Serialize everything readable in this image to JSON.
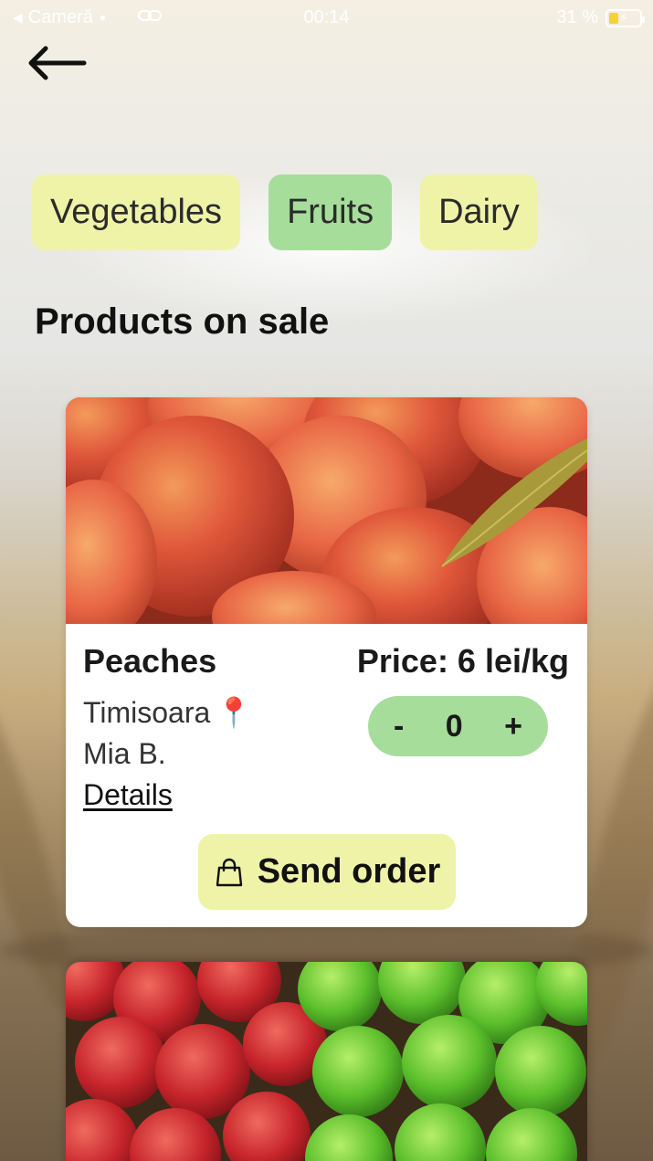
{
  "status_bar": {
    "back_app": "Cameră",
    "time": "00:14",
    "battery": "31 %",
    "battery_level": 0.31
  },
  "categories": [
    {
      "label": "Vegetables",
      "active": false
    },
    {
      "label": "Fruits",
      "active": true
    },
    {
      "label": "Dairy",
      "active": false
    }
  ],
  "section_title": "Products on sale",
  "product": {
    "name": "Peaches",
    "price": "Price: 6 lei/kg",
    "location": "Timisoara",
    "location_icon": "📍",
    "seller": "Mia B.",
    "details_label": "Details",
    "quantity": "0",
    "minus_label": "-",
    "plus_label": "+",
    "send_label": "Send order"
  },
  "colors": {
    "chip": "#eff3a8",
    "chip_active": "#a6dd9b",
    "stepper": "#a6dd9b",
    "send_button": "#eff3a8"
  }
}
